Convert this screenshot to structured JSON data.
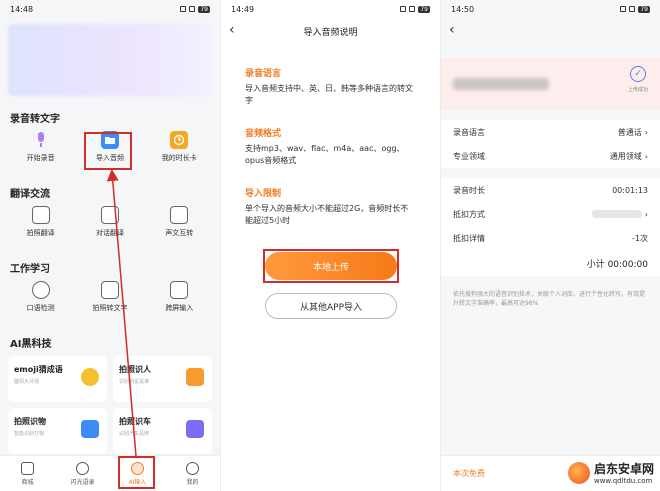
{
  "phone1": {
    "time": "14:48",
    "battery": "79",
    "sections": [
      {
        "title": "录音转文字",
        "items": [
          {
            "label": "开始录音",
            "icon": "microphone-icon",
            "color": "#b57bf0"
          },
          {
            "label": "导入音频",
            "icon": "folder-icon",
            "color": "#3d8cf5"
          },
          {
            "label": "我的时长卡",
            "icon": "clock-icon",
            "color": "#f5a623"
          }
        ]
      },
      {
        "title": "翻译交流",
        "items": [
          {
            "label": "拍照翻译",
            "icon": "camera-icon"
          },
          {
            "label": "对话翻译",
            "icon": "chat-icon"
          },
          {
            "label": "声文互转",
            "icon": "switch-icon"
          }
        ]
      },
      {
        "title": "工作学习",
        "items": [
          {
            "label": "口语检测",
            "icon": "speech-icon"
          },
          {
            "label": "拍照转文字",
            "icon": "text-scan-icon"
          },
          {
            "label": "跨屏输入",
            "icon": "screen-icon"
          }
        ]
      }
    ],
    "ai_title": "AI黑科技",
    "ai_cards": [
      {
        "title": "emoji猜成语",
        "sub": "脑洞大评测",
        "color": "#f5c12c"
      },
      {
        "title": "拍照识人",
        "sub": "识别明星是谁",
        "color": "#f59c2c"
      },
      {
        "title": "拍照识物",
        "sub": "智能识别万物",
        "color": "#3d8cf5"
      },
      {
        "title": "拍照识车",
        "sub": "识别汽车品牌",
        "color": "#7b6cf5"
      }
    ],
    "tabs": [
      {
        "label": "商城"
      },
      {
        "label": "闪光语录"
      },
      {
        "label": "AI输入"
      },
      {
        "label": "我的"
      }
    ]
  },
  "phone2": {
    "time": "14:49",
    "battery": "79",
    "title": "导入音频说明",
    "blocks": [
      {
        "heading": "录音语言",
        "text": "导入音频支持中、英、日、韩等多种语言的转文字"
      },
      {
        "heading": "音频格式",
        "text": "支持mp3、wav、flac、m4a、aac、ogg、opus音频格式"
      },
      {
        "heading": "导入限制",
        "text": "单个导入的音频大小不能超过2G，音频时长不能超过5小时"
      }
    ],
    "primary_button": "本地上传",
    "secondary_button": "从其他APP导入"
  },
  "phone3": {
    "time": "14:50",
    "battery": "79",
    "upload_status": "上传成功",
    "rows_a": [
      {
        "label": "录音语言",
        "value": "普通话"
      },
      {
        "label": "专业领域",
        "value": "通用领域"
      }
    ],
    "rows_b": [
      {
        "label": "录音时长",
        "value": "00:01:13"
      },
      {
        "label": "抵扣方式",
        "value": ""
      },
      {
        "label": "抵扣详情",
        "value": "-1次"
      }
    ],
    "subtotal": "小计 00:00:00",
    "note": "依托搜狗强大的语音识别技术，关联个人词库，进行个性化转写。有效提升转文字准确率，最高可达98%",
    "footer": "本次免费"
  },
  "watermark": {
    "name": "启东安卓网",
    "url": "www.qdltdu.com"
  },
  "colors": {
    "orange": "#f07d23",
    "highlight_red": "#d42b2b"
  }
}
